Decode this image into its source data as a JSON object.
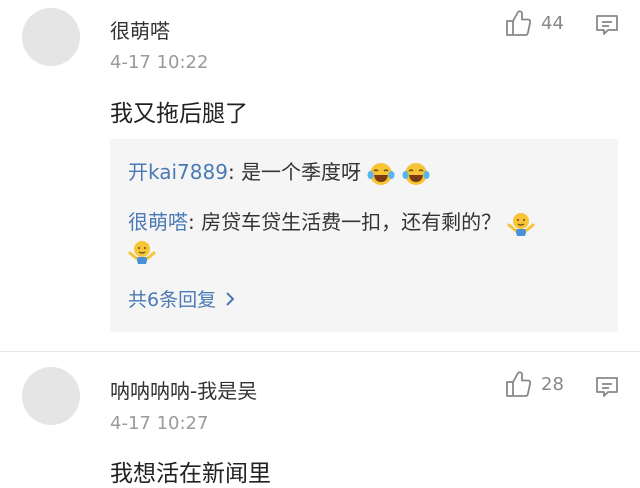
{
  "comments": [
    {
      "username": "很萌嗒",
      "time": "4-17 10:22",
      "text": "我又拖后腿了",
      "likes": "44",
      "replies": [
        {
          "user": "开kai7889",
          "sep": ": ",
          "text": "是一个季度呀",
          "emoji": "laugh-cry-emoji"
        },
        {
          "user": "很萌嗒",
          "sep": ": ",
          "text": "房贷车贷生活费一扣，还有剩的？",
          "emoji": "shrug-emoji"
        }
      ],
      "more_replies": "共6条回复"
    },
    {
      "username": "呐呐呐呐-我是吴",
      "time": "4-17 10:27",
      "text": "我想活在新闻里",
      "likes": "28"
    }
  ],
  "colors": {
    "link_blue": "#4a7ab5",
    "meta_gray": "#9a9a9a",
    "reply_bg": "#f5f5f5"
  }
}
